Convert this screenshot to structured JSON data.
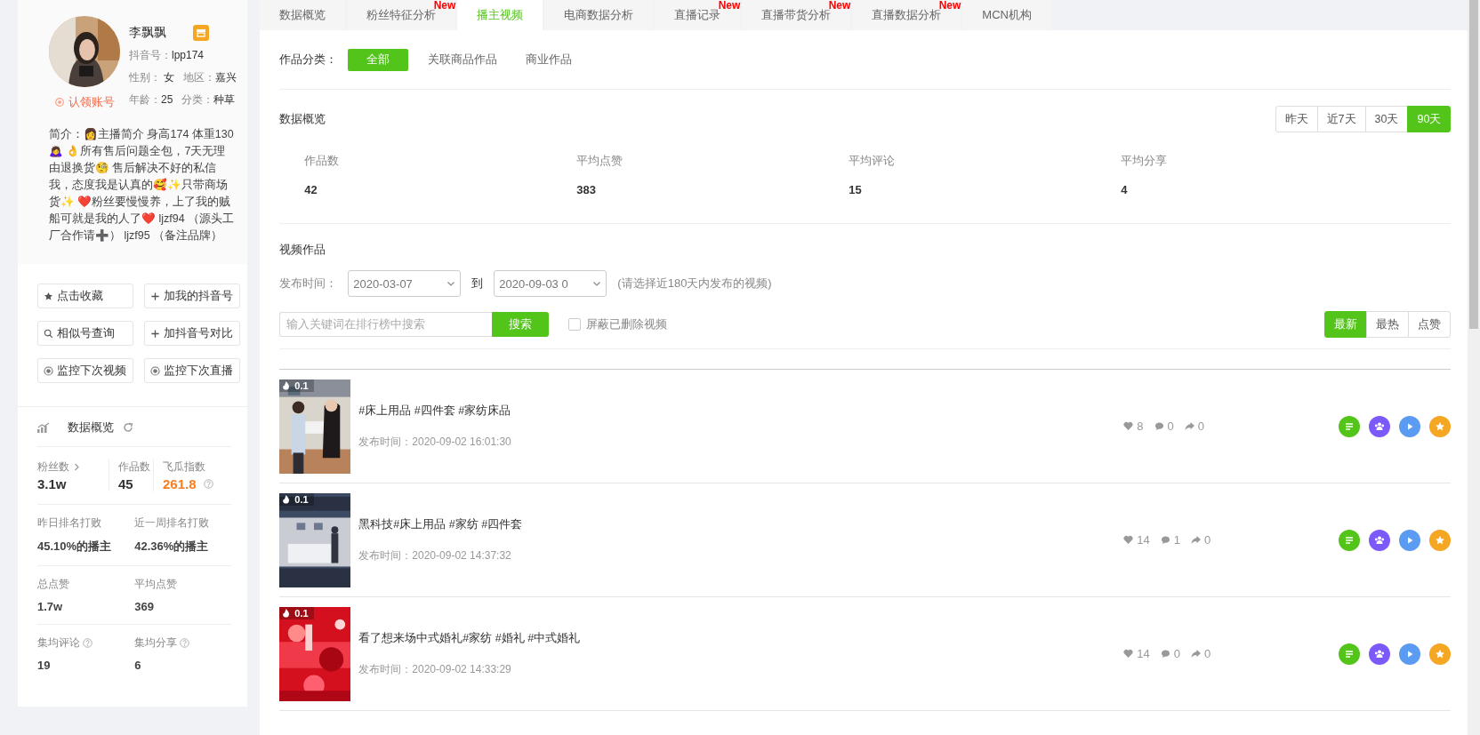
{
  "profile": {
    "name": "李飘飘",
    "douyin_label": "抖音号：",
    "douyin_id": "lpp174",
    "gender_label": "性别：",
    "gender": "女",
    "region_label": "地区：",
    "region": "嘉兴",
    "age_label": "年龄：",
    "age": "25",
    "category_label": "分类：",
    "category": "种草",
    "claim": "认领账号",
    "bio": "简介：👩主播简介 身高174 体重130🙇‍♀️ 👌所有售后问题全包，7天无理由退换货🧐 售后解决不好的私信我，态度我是认真的🥰✨只带商场货✨ ❤️粉丝要慢慢养，上了我的贼船可就是我的人了❤️ ljzf94 （源头工厂合作请➕） ljzf95 （备注品牌）"
  },
  "actions": [
    {
      "kind": "star",
      "label": "点击收藏"
    },
    {
      "kind": "plus",
      "label": "加我的抖音号"
    },
    {
      "kind": "search",
      "label": "相似号查询"
    },
    {
      "kind": "plus",
      "label": "加抖音号对比"
    },
    {
      "kind": "eye",
      "label": "监控下次视频"
    },
    {
      "kind": "eye",
      "label": "监控下次直播"
    }
  ],
  "overview": {
    "title": "数据概览",
    "fans_label": "粉丝数",
    "fans": "3.1w",
    "works_label": "作品数",
    "works": "45",
    "index_label": "飞瓜指数",
    "index": "261.8",
    "stats": [
      {
        "label": "昨日排名打败",
        "value": "45.10%的播主",
        "help": false
      },
      {
        "label": "近一周排名打败",
        "value": "42.36%的播主",
        "help": false
      },
      {
        "label": "总点赞",
        "value": "1.7w",
        "help": false
      },
      {
        "label": "平均点赞",
        "value": "369",
        "help": false
      },
      {
        "label": "集均评论",
        "value": "19",
        "help": true
      },
      {
        "label": "集均分享",
        "value": "6",
        "help": true
      }
    ]
  },
  "tabs": [
    {
      "label": "数据概览",
      "selected": false
    },
    {
      "label": "粉丝特征分析",
      "selected": false,
      "badge": "New"
    },
    {
      "label": "播主视频",
      "selected": true
    },
    {
      "label": "电商数据分析",
      "selected": false
    },
    {
      "label": "直播记录",
      "selected": false,
      "badge": "New"
    },
    {
      "label": "直播带货分析",
      "selected": false,
      "badge": "New"
    },
    {
      "label": "直播数据分析",
      "selected": false,
      "badge": "New"
    },
    {
      "label": "MCN机构",
      "selected": false
    }
  ],
  "category_filter": {
    "label": "作品分类：",
    "options": [
      {
        "label": "全部",
        "selected": true
      },
      {
        "label": "关联商品作品",
        "selected": false
      },
      {
        "label": "商业作品",
        "selected": false
      }
    ]
  },
  "data_overview": {
    "title": "数据概览",
    "ranges": [
      {
        "label": "昨天",
        "selected": false
      },
      {
        "label": "近7天",
        "selected": false
      },
      {
        "label": "30天",
        "selected": false
      },
      {
        "label": "90天",
        "selected": true
      }
    ],
    "metrics": [
      {
        "label": "作品数",
        "value": "42"
      },
      {
        "label": "平均点赞",
        "value": "383"
      },
      {
        "label": "平均评论",
        "value": "15"
      },
      {
        "label": "平均分享",
        "value": "4"
      }
    ]
  },
  "videos": {
    "title": "视频作品",
    "date_label": "发布时间：",
    "start": "2020-03-07",
    "to": "到",
    "end": "2020-09-03 0",
    "hint": "(请选择近180天内发布的视频)",
    "search_placeholder": "输入关键词在排行榜中搜索",
    "search_button": "搜索",
    "hide_deleted": {
      "label": "屏蔽已删除视频",
      "checked": false
    },
    "sorts": [
      {
        "label": "最新",
        "selected": true
      },
      {
        "label": "最热",
        "selected": false
      },
      {
        "label": "点赞",
        "selected": false
      }
    ],
    "items": [
      {
        "score": "0.1",
        "title": "#床上用品 #四件套 #家纺床品",
        "time": "发布时间：2020-09-02 16:01:30",
        "likes": "8",
        "comments": "0",
        "shares": "0"
      },
      {
        "score": "0.1",
        "title": "黑科技#床上用品 #家纺 #四件套",
        "time": "发布时间：2020-09-02 14:37:32",
        "likes": "14",
        "comments": "1",
        "shares": "0"
      },
      {
        "score": "0.1",
        "title": "看了想来场中式婚礼#家纺 #婚礼 #中式婚礼",
        "time": "发布时间：2020-09-02 14:33:29",
        "likes": "14",
        "comments": "0",
        "shares": "0"
      }
    ]
  }
}
